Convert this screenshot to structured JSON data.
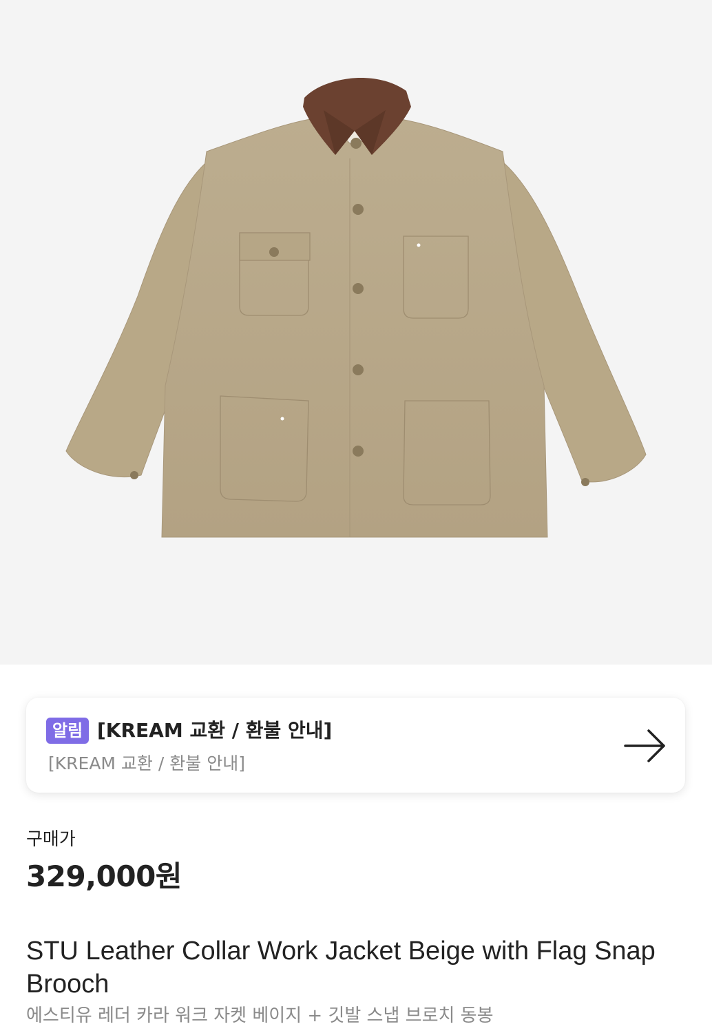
{
  "colors": {
    "badge": "#7f6ce6",
    "hero_bg": "#f4f4f4",
    "jacket": "#b9a98a",
    "collar": "#6b4130"
  },
  "product_image": {
    "icon": "jacket-image"
  },
  "notice": {
    "badge": "알림",
    "title": "[KREAM 교환 / 환불 안내]",
    "subtitle": "[KREAM 교환 / 환불 안내]",
    "arrow_icon": "arrow-right-icon"
  },
  "pricing": {
    "label": "구매가",
    "value": "329,000원"
  },
  "product": {
    "title": "STU Leather Collar Work Jacket Beige with Flag Snap Brooch",
    "subtitle": "에스티유 레더 카라 워크 자켓 베이지 + 깃발 스냅 브로치 동봉"
  }
}
